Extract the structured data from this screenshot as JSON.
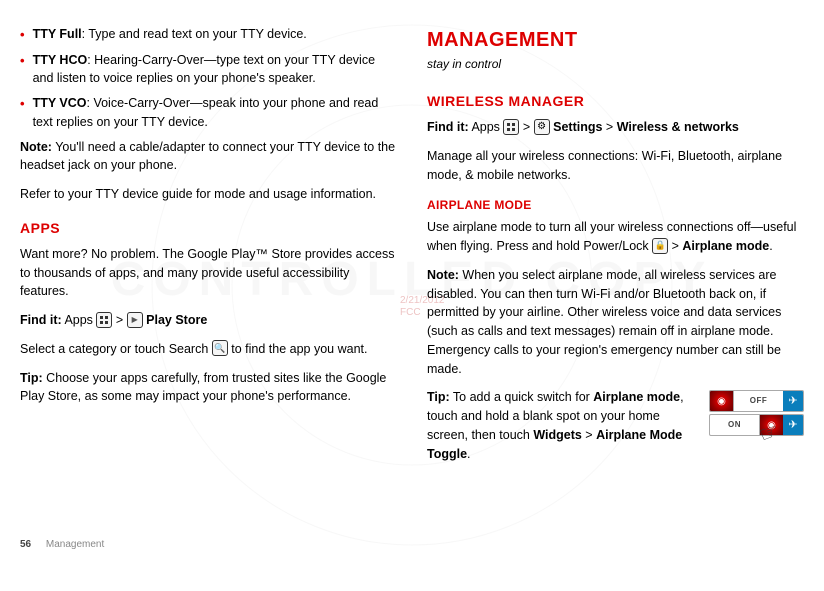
{
  "left": {
    "bullets": [
      {
        "term": "TTY Full",
        "desc": ": Type and read text on your TTY device."
      },
      {
        "term": "TTY HCO",
        "desc": ": Hearing-Carry-Over—type text on your TTY device and listen to voice replies on your phone's speaker."
      },
      {
        "term": "TTY VCO",
        "desc": ": Voice-Carry-Over—speak into your phone and read text replies on your TTY device."
      }
    ],
    "note_label": "Note:",
    "note_text": " You'll need a cable/adapter to connect your TTY device to the headset jack on your phone.",
    "refer": "Refer to your TTY device guide for mode and usage information.",
    "apps_title": "APPS",
    "apps_intro": "Want more? No problem. The Google Play™ Store provides access to thousands of apps, and many provide useful accessibility features.",
    "findit_label": "Find it:",
    "findit_apps": " Apps ",
    "gt": " > ",
    "play_store": " Play Store",
    "select_text_a": "Select a category or touch Search ",
    "select_text_b": " to find the app you want.",
    "tip_label": "Tip:",
    "tip_text": " Choose your apps carefully, from trusted sites like the Google Play Store, as some may impact your phone's performance."
  },
  "right": {
    "mega": "MANAGEMENT",
    "tagline": "stay in control",
    "wm_title": "WIRELESS MANAGER",
    "findit_label": "Find it:",
    "findit_apps": " Apps ",
    "gt": " > ",
    "settings": " Settings",
    "wn": "Wireless & networks",
    "manage_text": "Manage all your wireless connections: Wi-Fi, Bluetooth, airplane mode, & mobile networks.",
    "am_title": "AIRPLANE MODE",
    "am_text_a": "Use airplane mode to turn all your wireless connections off—useful when flying. Press and hold Power/Lock ",
    "am_text_b": " > ",
    "am_text_c": "Airplane mode",
    "am_text_d": ".",
    "note_label": "Note:",
    "note_text": " When you select airplane mode, all wireless services are disabled. You can then turn Wi-Fi and/or Bluetooth back on, if permitted by your airline. Other wireless voice and data services (such as calls and text messages) remain off in airplane mode. Emergency calls to your region's emergency number can still be made.",
    "tip_label": "Tip:",
    "tip_a": " To add a quick switch for ",
    "tip_b": "Airplane mode",
    "tip_c": ", touch and hold a blank spot on your home screen, then touch ",
    "tip_d": "Widgets",
    "tip_e": " > ",
    "tip_f": "Airplane Mode Toggle",
    "tip_g": ".",
    "toggle_off": "OFF",
    "toggle_on": "ON"
  },
  "footer": {
    "page": "56",
    "section": "Management"
  },
  "draft": {
    "line1": "2/21/2012",
    "line2": "FCC"
  }
}
